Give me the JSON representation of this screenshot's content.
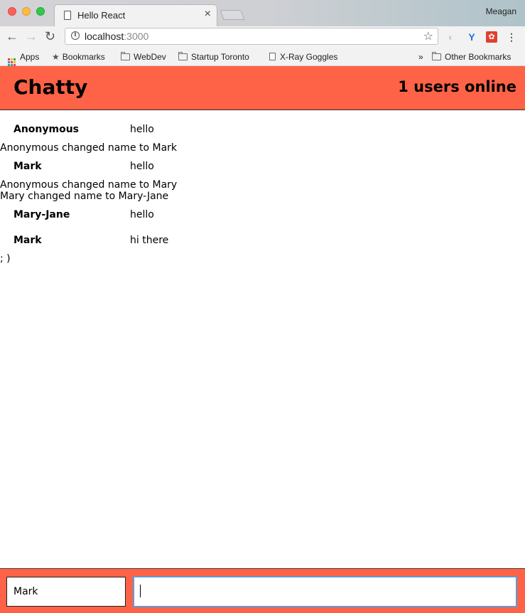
{
  "browser": {
    "tab_title": "Hello React",
    "profile_name": "Meagan",
    "url_host": "localhost",
    "url_port": ":3000",
    "bookmarks": [
      {
        "label": "Apps",
        "icon": "apps-grid-icon"
      },
      {
        "label": "Bookmarks",
        "icon": "star-icon"
      },
      {
        "label": "WebDev",
        "icon": "folder-icon"
      },
      {
        "label": "Startup Toronto",
        "icon": "folder-icon"
      },
      {
        "label": "X-Ray Goggles",
        "icon": "page-icon"
      }
    ],
    "overflow": "»",
    "other_bookmarks": "Other Bookmarks"
  },
  "app": {
    "brand": "Chatty",
    "online_count": "1 users online"
  },
  "messages": [
    {
      "type": "message",
      "user": "Anonymous",
      "content": "hello"
    },
    {
      "type": "notification",
      "text": "Anonymous changed name to Mark"
    },
    {
      "type": "message",
      "user": "Mark",
      "content": "hello"
    },
    {
      "type": "notification",
      "text": "Anonymous changed name to Mary"
    },
    {
      "type": "notification",
      "text": "Mary changed name to Mary-Jane"
    },
    {
      "type": "message",
      "user": "Mary-Jane",
      "content": "hello"
    },
    {
      "type": "message",
      "user": "Mark",
      "content": "hi there"
    },
    {
      "type": "notification",
      "text": "; )"
    }
  ],
  "chatbar": {
    "username_value": "Mark",
    "message_value": ""
  },
  "colors": {
    "accent": "#ff6347",
    "focus_border": "#5b9dd9"
  }
}
